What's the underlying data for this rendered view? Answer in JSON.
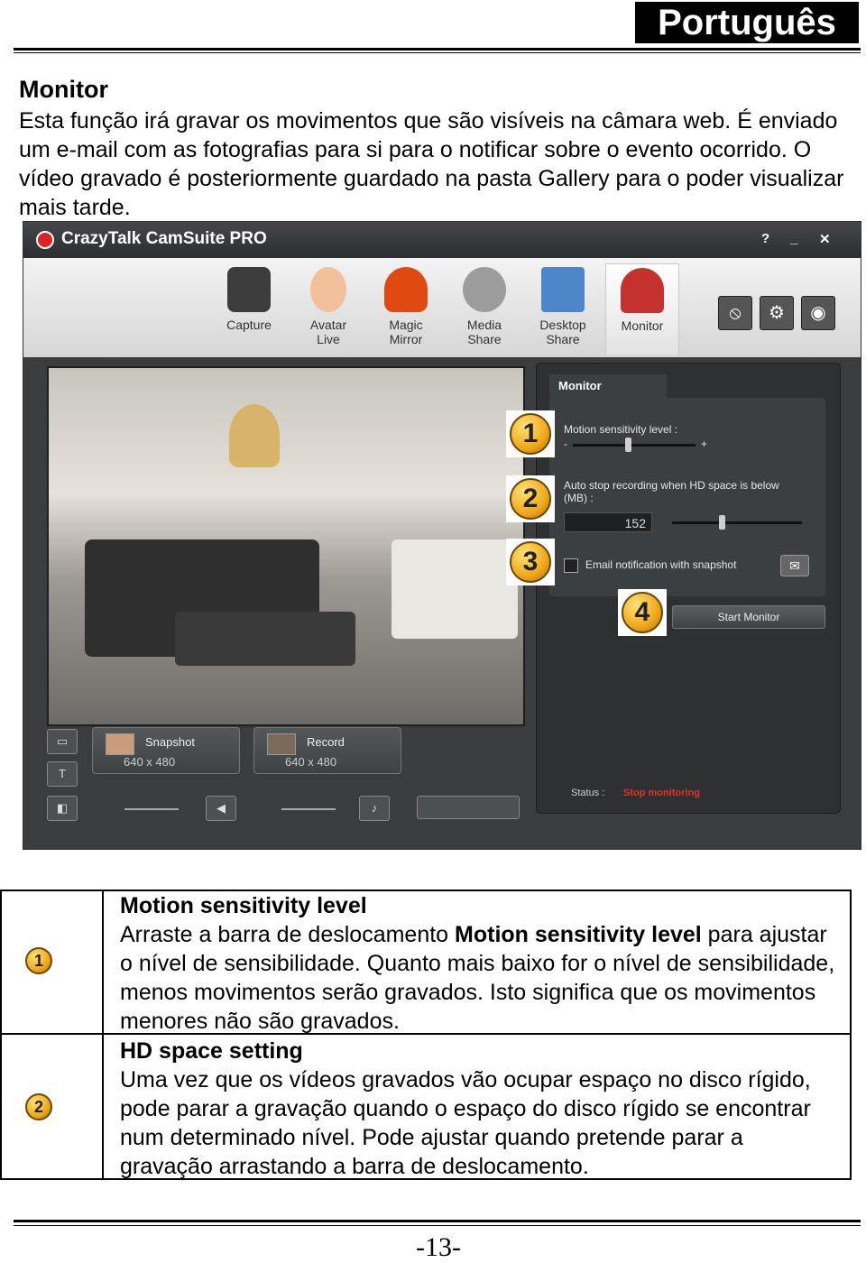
{
  "header": {
    "language": "Português"
  },
  "section": {
    "title": "Monitor",
    "intro": "Esta função irá gravar os movimentos que são visíveis na câmara web. É enviado um e-mail com as fotografias para si para o notificar sobre o evento ocorrido. O vídeo gravado é posteriormente guardado na pasta Gallery para o poder visualizar mais tarde."
  },
  "app": {
    "title": "CrazyTalk CamSuite PRO",
    "window_buttons": {
      "help": "?",
      "minimize": "_",
      "close": "✕"
    },
    "toolbar": [
      {
        "label": "Capture",
        "icon": "camera-icon"
      },
      {
        "label": "Avatar\nLive",
        "icon": "baby-face-icon"
      },
      {
        "label": "Magic\nMirror",
        "icon": "mask-icon"
      },
      {
        "label": "Media\nShare",
        "icon": "film-reel-icon"
      },
      {
        "label": "Desktop\nShare",
        "icon": "desktop-icon"
      },
      {
        "label": "Monitor",
        "icon": "security-camera-icon"
      }
    ],
    "monitor_panel": {
      "tab": "Monitor",
      "sensitivity_label": "Motion sensitivity level :",
      "minus": "-",
      "plus": "+",
      "sensitivity_level": 0.45,
      "auto_stop_label": "Auto stop recording when HD space is below (MB) :",
      "auto_stop_value": "152",
      "email_label": "Email notification with snapshot",
      "start_button": "Start Monitor",
      "status_label": "Status :",
      "status_value": "Stop monitoring"
    },
    "callouts": [
      "1",
      "2",
      "3",
      "4"
    ],
    "capture_controls": {
      "snapshot_label": "Snapshot",
      "snapshot_size": "640 x 480",
      "record_label": "Record",
      "record_size": "640 x 480"
    }
  },
  "table": {
    "rows": [
      {
        "num": "1",
        "heading": "Motion sensitivity level",
        "text_pre": "Arraste a barra de deslocamento ",
        "text_bold": "Motion sensitivity level",
        "text_post": " para ajustar o nível de sensibilidade. Quanto mais baixo for o nível de sensibilidade, menos movimentos serão gravados. Isto significa que os movimentos menores não são gravados."
      },
      {
        "num": "2",
        "heading": "HD space setting",
        "text": "Uma vez que os vídeos gravados vão ocupar espaço no disco rígido, pode parar a gravação quando o espaço do disco rígido se encontrar num determinado nível. Pode ajustar quando pretende parar a gravação arrastando a barra de deslocamento."
      }
    ]
  },
  "footer": {
    "page": "-13-"
  }
}
